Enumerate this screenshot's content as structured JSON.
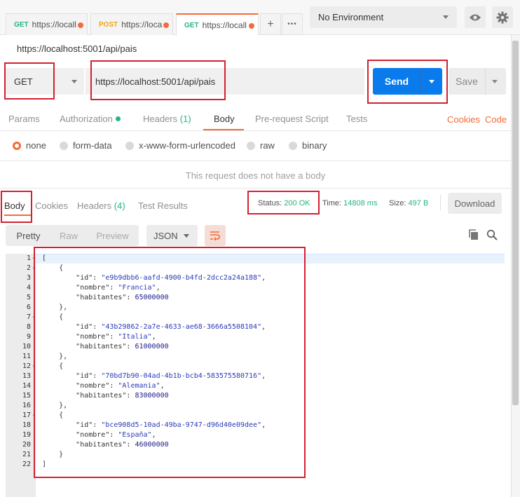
{
  "tabs": [
    {
      "method": "GET",
      "label": "https://locall",
      "method_color": "#26b47f"
    },
    {
      "method": "POST",
      "label": "https://loca",
      "method_color": "#f2a516"
    },
    {
      "method": "GET",
      "label": "https://locall",
      "method_color": "#26b47f"
    }
  ],
  "tab_actions": {
    "add": "+",
    "more": "•••"
  },
  "environment": {
    "selected": "No Environment"
  },
  "request": {
    "title": "https://localhost:5001/api/pais",
    "method": "GET",
    "url": "https://localhost:5001/api/pais",
    "send_label": "Send",
    "save_label": "Save"
  },
  "request_tabs": {
    "params": "Params",
    "authorization": "Authorization",
    "headers": "Headers",
    "headers_count": "(1)",
    "body": "Body",
    "prerequest": "Pre-request Script",
    "tests": "Tests",
    "cookies": "Cookies",
    "code": "Code"
  },
  "body_options": {
    "none": "none",
    "form_data": "form-data",
    "urlencoded": "x-www-form-urlencoded",
    "raw": "raw",
    "binary": "binary",
    "selected": "none"
  },
  "no_body_message": "This request does not have a body",
  "response": {
    "tabs": {
      "body": "Body",
      "cookies": "Cookies",
      "headers": "Headers",
      "headers_count": "(4)",
      "test_results": "Test Results"
    },
    "status_label": "Status:",
    "status_value": "200 OK",
    "time_label": "Time:",
    "time_value": "14808 ms",
    "size_label": "Size:",
    "size_value": "497 B",
    "download": "Download",
    "format": {
      "pretty": "Pretty",
      "raw": "Raw",
      "preview": "Preview",
      "type": "JSON"
    }
  },
  "code_lines": [
    {
      "t": "["
    },
    {
      "t": "    {"
    },
    {
      "t": "        \"id\": \"e9b9dbb6-aafd-4900-b4fd-2dcc2a24a188\","
    },
    {
      "t": "        \"nombre\": \"Francia\","
    },
    {
      "t": "        \"habitantes\": 65000000"
    },
    {
      "t": "    },"
    },
    {
      "t": "    {"
    },
    {
      "t": "        \"id\": \"43b29862-2a7e-4633-ae68-3666a5508104\","
    },
    {
      "t": "        \"nombre\": \"Italia\","
    },
    {
      "t": "        \"habitantes\": 61000000"
    },
    {
      "t": "    },"
    },
    {
      "t": "    {"
    },
    {
      "t": "        \"id\": \"70bd7b90-04ad-4b1b-bcb4-583575580716\","
    },
    {
      "t": "        \"nombre\": \"Alemania\","
    },
    {
      "t": "        \"habitantes\": 83000000"
    },
    {
      "t": "    },"
    },
    {
      "t": "    {"
    },
    {
      "t": "        \"id\": \"bce908d5-10ad-49ba-9747-d96d40e09dee\","
    },
    {
      "t": "        \"nombre\": \"España\","
    },
    {
      "t": "        \"habitantes\": 46000000"
    },
    {
      "t": "    }"
    },
    {
      "t": "]"
    }
  ],
  "colors": {
    "accent": "#f26b3a",
    "send": "#097bed",
    "success": "#26b47f",
    "highlight": "#d42030"
  }
}
